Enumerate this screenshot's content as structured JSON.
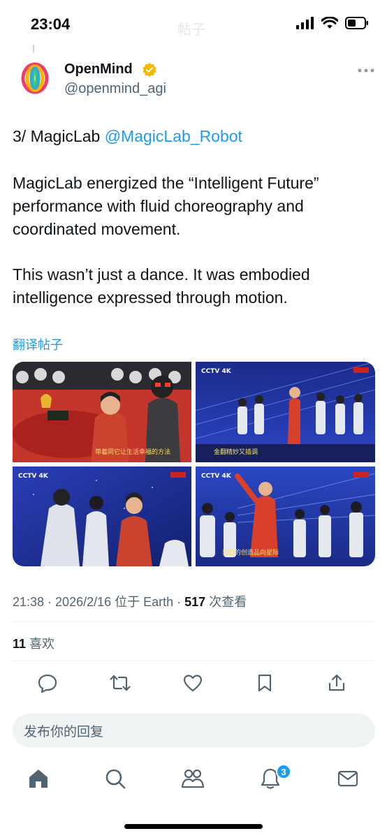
{
  "status_bar": {
    "time": "23:04",
    "faded_title": "帖子"
  },
  "author": {
    "name": "OpenMind",
    "handle": "@openmind_agi",
    "verified": true,
    "verified_color": "#f5b800"
  },
  "tweet": {
    "line1_prefix": "3/ MagicLab ",
    "line1_mention": "@MagicLab_Robot",
    "paragraph1": "MagicLab energized the “Intelligent Future” performance with fluid choreography and coordinated movement.",
    "paragraph2": "This wasn’t just a dance. It was embodied intelligence expressed through motion.",
    "translate_label": "翻译帖子"
  },
  "media": [
    {
      "caption": "带着同它让生活幸福的方法"
    },
    {
      "caption": "金翻精妙又插调",
      "broadcast_tag": "CCTV 4K"
    },
    {
      "broadcast_tag": "CCTV 4K"
    },
    {
      "caption": "我们的创造品向星际",
      "broadcast_tag": "CCTV 4K"
    }
  ],
  "meta": {
    "time": "21:38",
    "separator": " · ",
    "date_location": "2026/2/16 位于 Earth",
    "views_count": "517",
    "views_label": " 次查看",
    "likes_count": "11",
    "likes_label": " 喜欢"
  },
  "actions": [
    "reply-icon",
    "retweet-icon",
    "like-icon",
    "bookmark-icon",
    "share-icon"
  ],
  "reply_placeholder": "发布你的回复",
  "nav": {
    "items": [
      "home-icon",
      "search-icon",
      "communities-icon",
      "notifications-icon",
      "messages-icon"
    ],
    "notification_count": "3"
  },
  "colors": {
    "accent": "#1d9bf0",
    "text": "#0f1419",
    "secondary": "#536471"
  }
}
